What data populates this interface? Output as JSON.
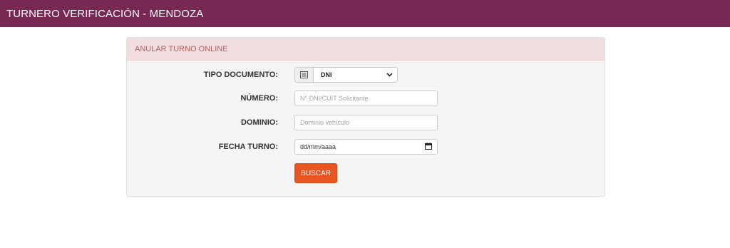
{
  "header": {
    "title": "TURNERO VERIFICACIÓN - MENDOZA"
  },
  "panel": {
    "title": "ANULAR TURNO ONLINE",
    "fields": {
      "tipo_documento": {
        "label": "TIPO DOCUMENTO:",
        "icon": "id-card-icon",
        "selected": "DNI"
      },
      "numero": {
        "label": "NÚMERO:",
        "placeholder": "N° DNI/CUIT Solicitante"
      },
      "dominio": {
        "label": "DOMINIO:",
        "placeholder": "Dominio vehículo"
      },
      "fecha_turno": {
        "label": "FECHA TURNO:",
        "value": "dd/mm/aaaa",
        "icon": "calendar-icon"
      }
    },
    "submit_label": "BUSCAR"
  },
  "colors": {
    "topbar": "#772953",
    "panel_heading_bg": "#f2dede",
    "panel_heading_text": "#b35c5c",
    "button": "#e95420"
  }
}
